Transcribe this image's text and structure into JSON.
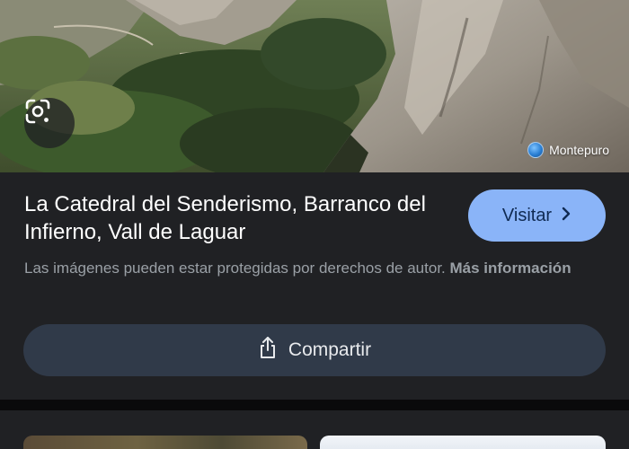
{
  "hero": {
    "lens_icon": "google-lens-icon",
    "source_name": "Montepuro",
    "source_icon": "globe-favicon-icon"
  },
  "card": {
    "title": "La Catedral del Senderismo, Barranco del Infierno, Vall de Laguar",
    "visit_label": "Visitar",
    "visit_icon": "chevron-right-icon",
    "copyright_text": "Las imágenes pueden estar protegidas por derechos de autor.",
    "more_info_label": "Más información",
    "share_label": "Compartir",
    "share_icon": "share-icon"
  },
  "colors": {
    "background": "#202124",
    "visit_button": "#8ab4f8",
    "share_button": "#303a49"
  }
}
